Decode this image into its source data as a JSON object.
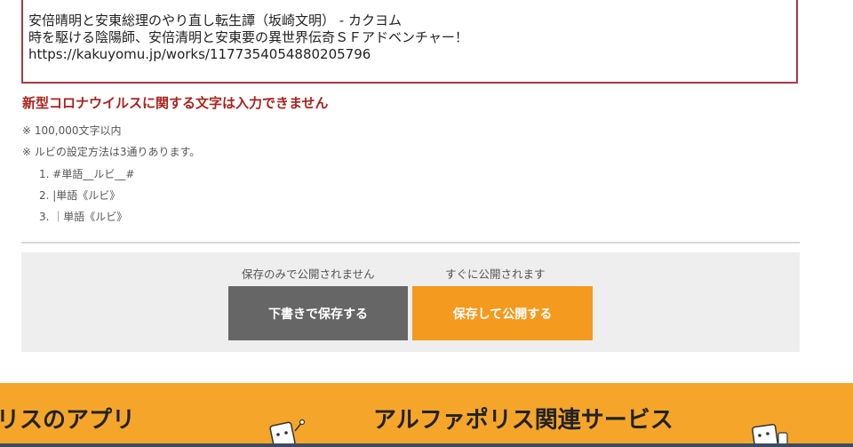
{
  "textarea": {
    "lines": [
      "安倍晴明と安東総理のやり直し転生譚（坂崎文明） - カクヨム",
      "時を駆ける陰陽師、安倍清明と安東要の異世界伝奇ＳＦアドベンチャー！",
      "https://kakuyomu.jp/works/1177354054880205796"
    ]
  },
  "error_message": "新型コロナウイルスに関する文字は入力できません",
  "notes": {
    "limit": "※ 100,000文字以内",
    "ruby_intro": "※ ルビの設定方法は3通りあります。",
    "ruby_rules": [
      "1. #単語__ルビ__#",
      "2. |単語《ルビ》",
      "3. ｜単語《ルビ》"
    ]
  },
  "actions": {
    "draft_hint": "保存のみで公開されません",
    "publish_hint": "すぐに公開されます",
    "draft_button": "下書きで保存する",
    "publish_button": "保存して公開する"
  },
  "footer": {
    "app_heading": "リスのアプリ",
    "services_heading": "アルファポリス関連サービス"
  },
  "colors": {
    "textarea_border": "#a43a4a",
    "error": "#a8231f",
    "draft_button": "#666666",
    "publish_button": "#f39a1f",
    "footer_band": "#f5a62a"
  }
}
